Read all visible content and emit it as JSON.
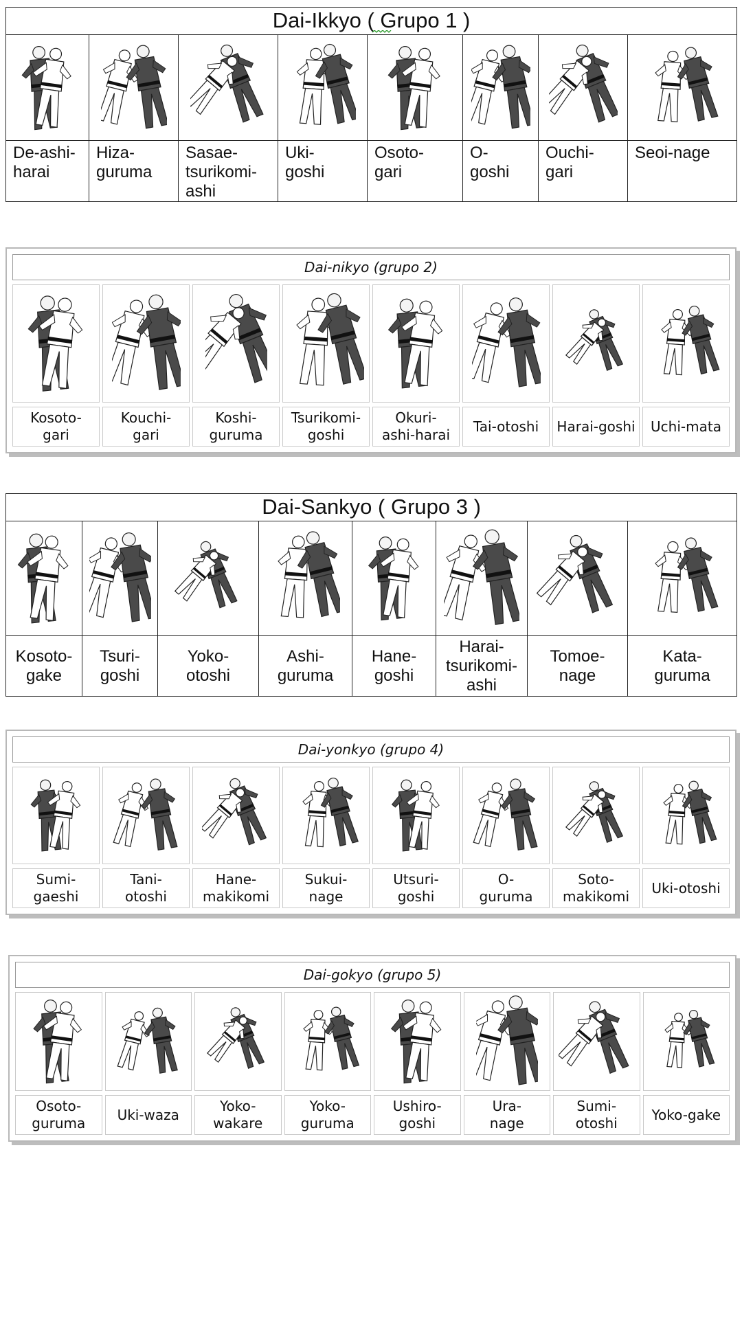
{
  "group1": {
    "title": "Dai-Ikkyo ( Grupo 1 )",
    "techniques": [
      "De-ashi-\nharai",
      "Hiza-\nguruma",
      "Sasae-\ntsurikomi-\nashi",
      "Uki-\ngoshi",
      "Osoto-\ngari",
      "O-\ngoshi",
      "Ouchi-\ngari",
      "Seoi-nage"
    ]
  },
  "group2": {
    "title": "Dai-nikyo (grupo 2)",
    "techniques": [
      "Kosoto-\ngari",
      "Kouchi-\ngari",
      "Koshi-\nguruma",
      "Tsurikomi-\ngoshi",
      "Okuri-\nashi-harai",
      "Tai-otoshi",
      "Harai-goshi",
      "Uchi-mata"
    ]
  },
  "group3": {
    "title": "Dai-Sankyo ( Grupo 3 )",
    "techniques": [
      "Kosoto-\ngake",
      "Tsuri-\ngoshi",
      "Yoko-\notoshi",
      "Ashi-\nguruma",
      "Hane-\ngoshi",
      "Harai-\ntsurikomi-\nashi",
      "Tomoe-\nnage",
      "Kata-\nguruma"
    ]
  },
  "group4": {
    "title": "Dai-yonkyo (grupo 4)",
    "techniques": [
      "Sumi-\ngaeshi",
      "Tani-\notoshi",
      "Hane-\nmakikomi",
      "Sukui-\nnage",
      "Utsuri-\ngoshi",
      "O-\nguruma",
      "Soto-\nmakikomi",
      "Uki-otoshi"
    ]
  },
  "group5": {
    "title": "Dai-gokyo (grupo 5)",
    "techniques": [
      "Osoto-\nguruma",
      "Uki-waza",
      "Yoko-\nwakare",
      "Yoko-guruma",
      "Ushiro-\ngoshi",
      "Ura-\nnage",
      "Sumi-\notoshi",
      "Yoko-gake"
    ]
  },
  "icons": {
    "figure": "judo-throw-illustration-icon"
  },
  "colors": {
    "gi_dark": "#4a4a4a",
    "gi_light": "#ffffff",
    "belt": "#111111",
    "frame_shadow": "#bdbdbd"
  }
}
